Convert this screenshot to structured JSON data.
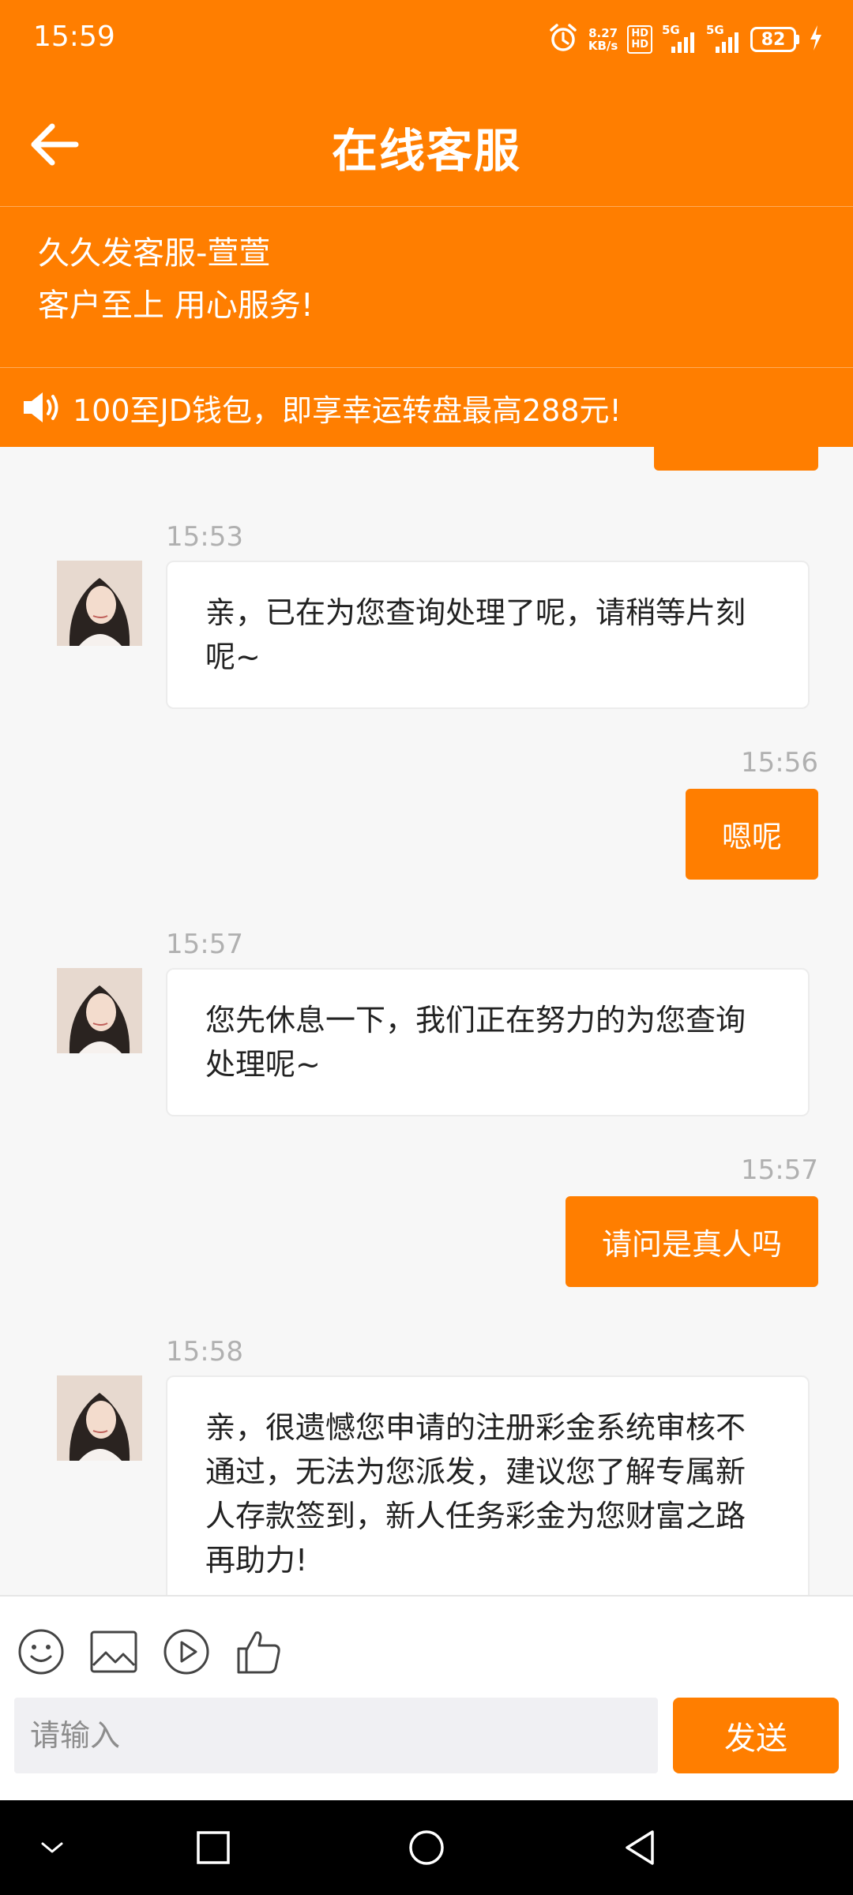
{
  "status_bar": {
    "time": "15:59",
    "net_speed_value": "8.27",
    "net_speed_unit": "KB/s",
    "network_1": "5G",
    "network_2": "5G",
    "battery": "82"
  },
  "header": {
    "title": "在线客服",
    "back_icon": "arrow-left-icon"
  },
  "agent": {
    "name": "久久发客服-萱萱",
    "motto": "客户至上 用心服务!"
  },
  "notice": {
    "icon": "speaker-icon",
    "text": "100至JD钱包，即享幸运转盘最高288元!"
  },
  "messages": [
    {
      "side": "agent",
      "time": "15:53",
      "text": "亲，已在为您查询处理了呢，请稍等片刻呢~"
    },
    {
      "side": "user",
      "time": "15:56",
      "text": "嗯呢"
    },
    {
      "side": "agent",
      "time": "15:57",
      "text": "您先休息一下，我们正在努力的为您查询处理呢~"
    },
    {
      "side": "user",
      "time": "15:57",
      "text": "请问是真人吗"
    },
    {
      "side": "agent",
      "time": "15:58",
      "text": "亲，很遗憾您申请的注册彩金系统审核不通过，无法为您派发，建议您了解专属新人存款签到，新人任务彩金为您财富之路再助力!"
    }
  ],
  "toolbar": {
    "icons": [
      "emoji-icon",
      "image-icon",
      "video-icon",
      "thumbs-up-icon"
    ]
  },
  "input": {
    "placeholder": "请输入",
    "value": ""
  },
  "send_label": "发送",
  "colors": {
    "accent": "#ff7e00",
    "chat_bg": "#f7f7f7",
    "timestamp": "#b0b0b0"
  }
}
